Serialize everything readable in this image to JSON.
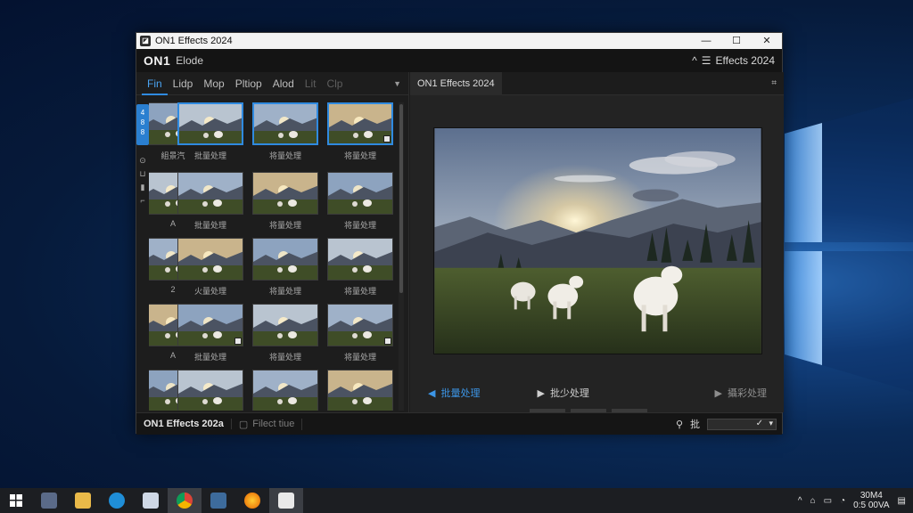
{
  "window": {
    "title": "ON1 Effects 2024",
    "controls": {
      "minimize": "—",
      "maximize": "☐",
      "close": "✕"
    }
  },
  "appbar": {
    "logo": "ON1",
    "mode": "Elode",
    "right_label": "Effects 2024",
    "right_caret": "^",
    "right_icon": "menu-icon"
  },
  "left_panel": {
    "tabs": [
      {
        "label": "Fin",
        "state": "active"
      },
      {
        "label": "Lidp",
        "state": "normal"
      },
      {
        "label": "Mop",
        "state": "normal"
      },
      {
        "label": "Pltiop",
        "state": "normal"
      },
      {
        "label": "Alod",
        "state": "normal"
      },
      {
        "label": "Lit",
        "state": "dim"
      },
      {
        "label": "Clp",
        "state": "dim"
      }
    ],
    "tab_menu_arrow": "▼",
    "side_strip": {
      "top": "4 8 8",
      "tools": [
        "⊙",
        "⊔",
        "▮",
        "⌐"
      ]
    },
    "thumbnail_rows": [
      [
        "組景汽",
        "批量处理",
        "将量处理",
        "将量处理"
      ],
      [
        "A",
        "批量处理",
        "将量处理",
        "将量处理"
      ],
      [
        "2",
        "火量处理",
        "将量处理",
        "将量处理"
      ],
      [
        "A",
        "批量处理",
        "将量处理",
        "将量处理"
      ],
      [
        "",
        "",
        "",
        ""
      ]
    ],
    "selected": [
      [
        0,
        1
      ],
      [
        0,
        2
      ],
      [
        0,
        3
      ]
    ],
    "marked": [
      [
        0,
        3
      ],
      [
        3,
        1
      ],
      [
        3,
        3
      ]
    ]
  },
  "right_panel": {
    "tab_label": "ON1 Effects 2024",
    "pin_icon": "pin-icon",
    "nav": {
      "prev_label": "批量处理",
      "play_label": "批少处理",
      "next_label": "攝彩处理"
    }
  },
  "statusbar": {
    "left_label": "ON1 Effects 202a",
    "filter_label": "Filect tiue",
    "right_label": "批",
    "ok_glyph": "✓",
    "dropdown_glyph": "▾"
  },
  "taskbar": {
    "clock_time": "30M4",
    "clock_date": "0:5 00VA",
    "apps": [
      "start-icon",
      "tools-icon",
      "folder-icon",
      "edge-icon",
      "snip-icon",
      "chrome-icon",
      "app-icon",
      "firefox-icon",
      "on1-icon"
    ]
  }
}
